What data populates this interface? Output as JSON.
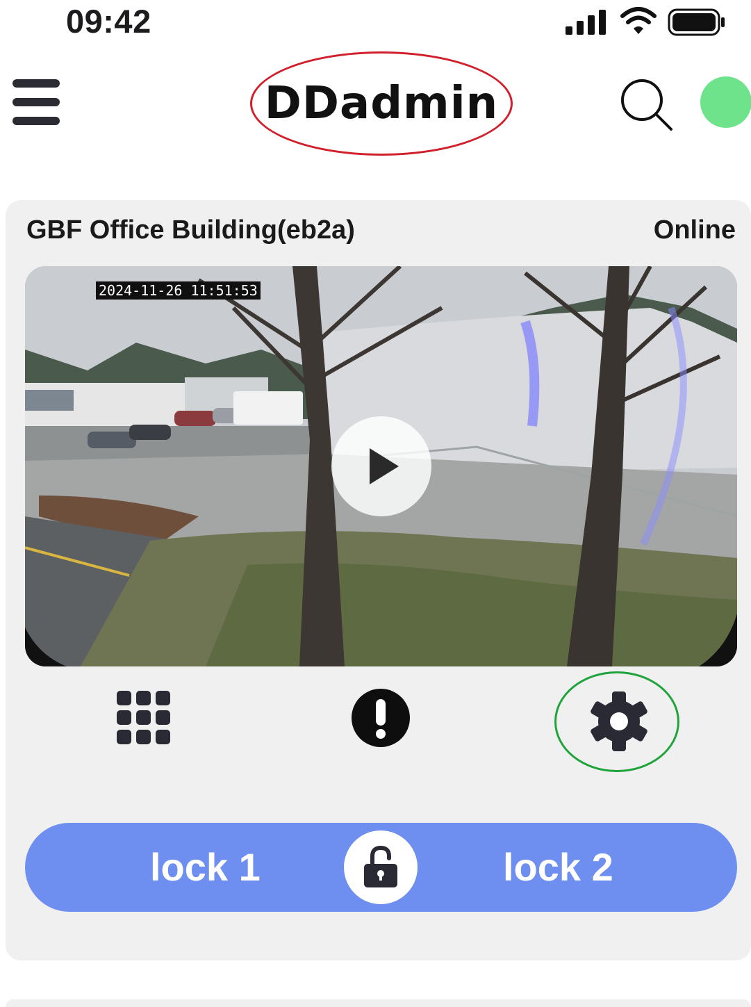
{
  "status_bar": {
    "time": "09:42"
  },
  "header": {
    "title": "DDadmin",
    "icons": [
      "menu-icon",
      "search-icon"
    ],
    "connection_dot_color": "#6ee38c",
    "title_highlight_color": "#d21f2c"
  },
  "device": {
    "name": "GBF Office Building(eb2a)",
    "status": "Online",
    "video": {
      "timestamp": "2024-11-26 11:51:53",
      "control_icon": "play-icon"
    },
    "actions": [
      {
        "icon": "keypad-icon"
      },
      {
        "icon": "alert-icon"
      },
      {
        "icon": "settings-icon",
        "highlight_color": "#1fa33b"
      }
    ],
    "locks": {
      "lock1_label": "lock 1",
      "lock2_label": "lock 2",
      "unlock_icon": "unlock-icon",
      "bar_color": "#6e8fef"
    }
  }
}
